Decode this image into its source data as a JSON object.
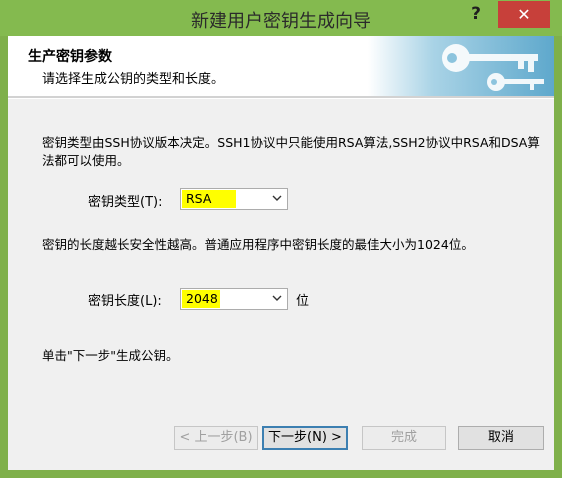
{
  "window": {
    "title": "新建用户密钥生成向导",
    "help_label": "?",
    "close_label": "✕"
  },
  "header": {
    "title": "生产密钥参数",
    "subtitle": "请选择生成公钥的类型和长度。",
    "graphic": "key-icon"
  },
  "content": {
    "type_description": "密钥类型由SSH协议版本决定。SSH1协议中只能使用RSA算法,SSH2协议中RSA和DSA算法都可以使用。",
    "type_label": "密钥类型(T):",
    "type_value": "RSA",
    "length_description": "密钥的长度越长安全性越高。普通应用程序中密钥长度的最佳大小为1024位。",
    "length_label": "密钥长度(L):",
    "length_value": "2048",
    "length_unit": "位",
    "hint": "单击\"下一步\"生成公钥。"
  },
  "buttons": {
    "back": "< 上一步(B)",
    "next": "下一步(N) >",
    "finish": "完成",
    "cancel": "取消"
  },
  "colors": {
    "titlebar": "#84ba4f",
    "close": "#c7403a",
    "highlight": "#ffff00",
    "header_graphic": "#7fbcd8"
  }
}
